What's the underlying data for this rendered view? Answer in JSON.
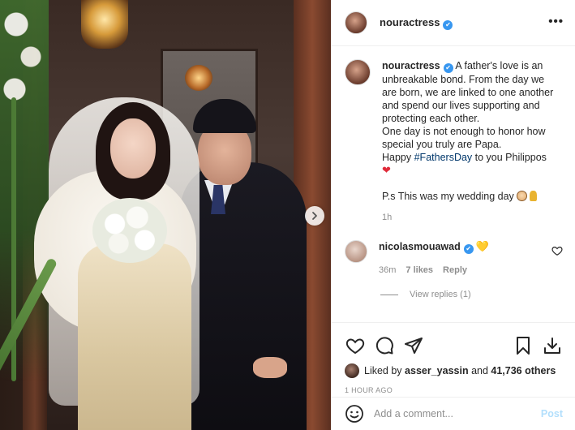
{
  "post": {
    "username": "nouractress",
    "verified_mark": "✔",
    "more_label": "•••",
    "caption": {
      "lines": [
        "A father's love is an",
        "unbreakable bond. From the day we",
        "are born, we are linked to one another",
        "and spend our lives supporting and",
        "protecting each other.",
        "One day is not enough to honor how",
        "special you truly are Papa."
      ],
      "happy_prefix": "Happy ",
      "hashtag": "#FathersDay",
      "happy_suffix": " to you Philippos",
      "heart": "❤",
      "ps": "P.s This was my wedding day",
      "time": "1h"
    }
  },
  "comment": {
    "username": "nicolasmouawad",
    "verified_mark": "✔",
    "emoji": "💛",
    "time": "36m",
    "likes": "7 likes",
    "reply": "Reply",
    "view_replies": "View replies (1)"
  },
  "likes": {
    "prefix": "Liked by ",
    "user": "asser_yassin",
    "and": " and ",
    "count": "41,736 others"
  },
  "timestamp": "1 HOUR AGO",
  "add_comment": {
    "placeholder": "Add a comment...",
    "post_label": "Post"
  },
  "icons": {
    "like": "heart-icon",
    "comment": "comment-icon",
    "share": "paper-plane-icon",
    "save": "bookmark-icon",
    "download": "download-icon",
    "emoji": "smile-icon",
    "next": "chevron-right-icon"
  }
}
